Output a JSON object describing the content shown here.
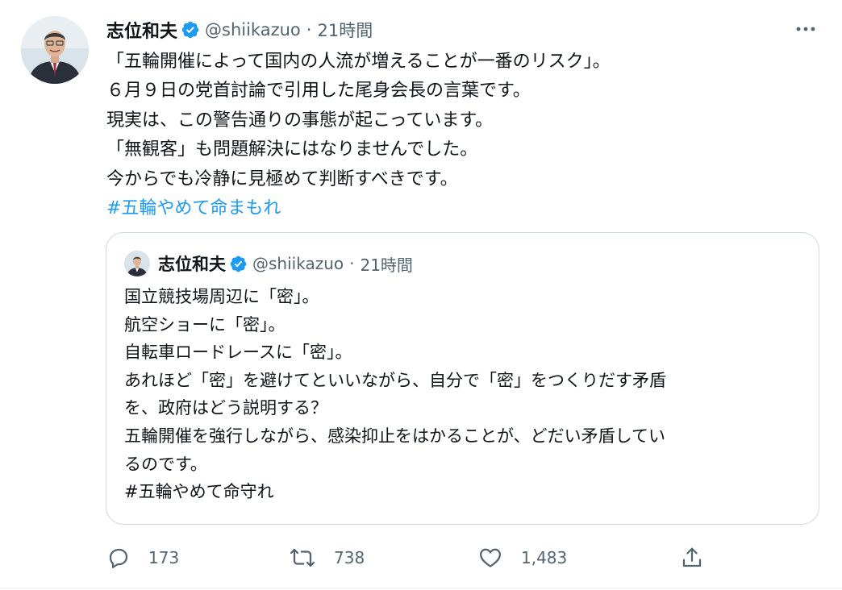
{
  "tweet": {
    "author_name": "志位和夫",
    "author_handle": "@shiikazuo",
    "separator": "·",
    "time": "21時間",
    "lines": [
      "「五輪開催によって国内の人流が増えることが一番のリスク」。",
      "６月９日の党首討論で引用した尾身会長の言葉です。",
      "現実は、この警告通りの事態が起こっています。",
      "「無観客」も問題解決にはなりませんでした。",
      "今からでも冷静に見極めて判断すべきです。"
    ],
    "hashtag": "#五輪やめて命まもれ",
    "more_icon": "more-horizontal-icon",
    "verified_icon": "verified-badge-icon"
  },
  "quoted_tweet": {
    "author_name": "志位和夫",
    "author_handle": "@shiikazuo",
    "separator": "·",
    "time": "21時間",
    "lines": [
      "国立競技場周辺に「密」。",
      "航空ショーに「密」。",
      "自転車ロードレースに「密」。",
      "あれほど「密」を避けてといいながら、自分で「密」をつくりだす矛盾",
      "を、政府はどう説明する？",
      "五輪開催を強行しながら、感染抑止をはかることが、どだい矛盾してい",
      "るのです。",
      "#五輪やめて命守れ"
    ]
  },
  "actions": {
    "reply": {
      "icon": "reply-icon",
      "count": "173"
    },
    "retweet": {
      "icon": "retweet-icon",
      "count": "738"
    },
    "like": {
      "icon": "heart-icon",
      "count": "1,483"
    },
    "share": {
      "icon": "share-icon"
    }
  },
  "colors": {
    "text_primary": "#0f1419",
    "text_secondary": "#536471",
    "link": "#1d9bf0",
    "verified": "#1d9bf0",
    "border": "#cfd9de"
  }
}
